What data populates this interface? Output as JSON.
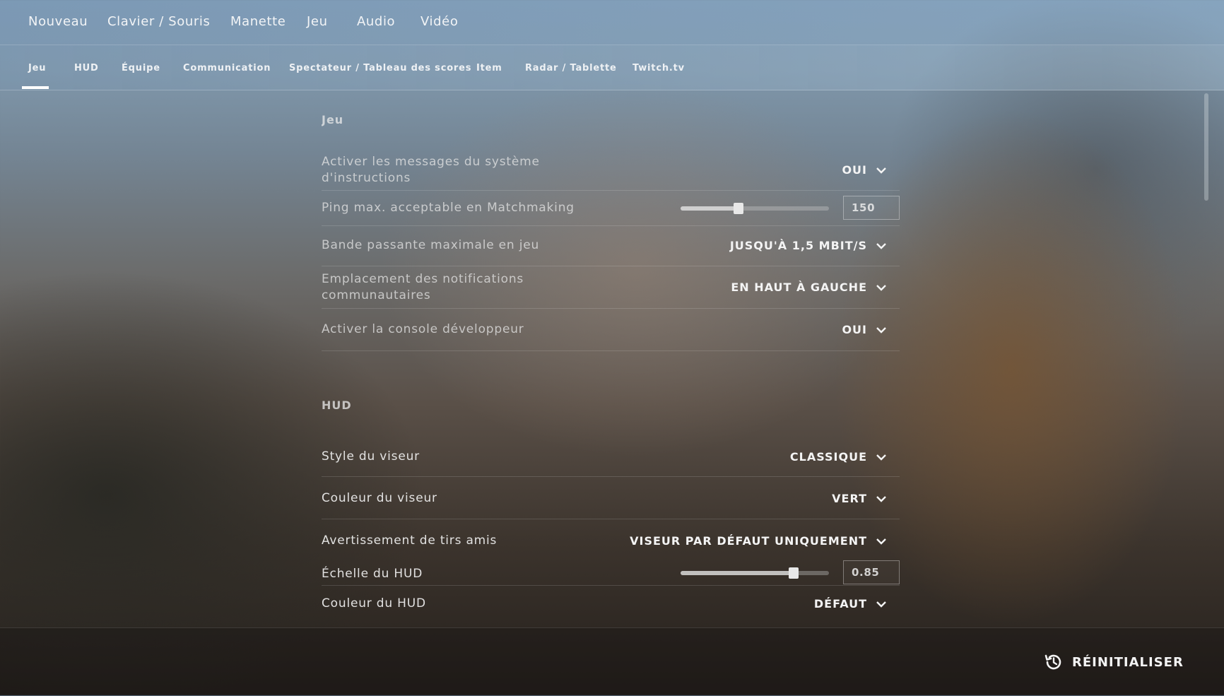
{
  "top_nav": {
    "items": [
      "Nouveau",
      "Clavier / Souris",
      "Manette",
      "Jeu",
      "Audio",
      "Vidéo"
    ]
  },
  "sub_nav": {
    "tabs": [
      "Jeu",
      "HUD",
      "Équipe",
      "Communication",
      "Spectateur / Tableau des scores",
      "Item",
      "Radar / Tablette",
      "Twitch.tv"
    ],
    "active": "Jeu"
  },
  "sections": {
    "jeu": {
      "title": "Jeu",
      "rows": [
        {
          "label": "Activer les messages du système d'instructions",
          "value": "OUI"
        },
        {
          "label": "Ping max. acceptable en Matchmaking",
          "value": "150",
          "slider_fraction": 0.39
        },
        {
          "label": "Bande passante maximale en jeu",
          "value": "JUSQU'À 1,5 MBIT/S"
        },
        {
          "label": "Emplacement des notifications communautaires",
          "value": "EN HAUT À GAUCHE"
        },
        {
          "label": "Activer la console développeur",
          "value": "OUI"
        }
      ]
    },
    "hud": {
      "title": "HUD",
      "rows": [
        {
          "label": "Style du viseur",
          "value": "CLASSIQUE"
        },
        {
          "label": "Couleur du viseur",
          "value": "VERT"
        },
        {
          "label": "Avertissement de tirs amis",
          "value": "VISEUR PAR DÉFAUT UNIQUEMENT"
        },
        {
          "label": "Échelle du HUD",
          "value": "0.85",
          "slider_fraction": 0.76
        },
        {
          "label": "Couleur du HUD",
          "value": "DÉFAUT"
        }
      ]
    }
  },
  "footer": {
    "reset_label": "RÉINITIALISER"
  },
  "icons": {
    "dropdown": "chevron-down-icon",
    "reset": "history-icon"
  }
}
